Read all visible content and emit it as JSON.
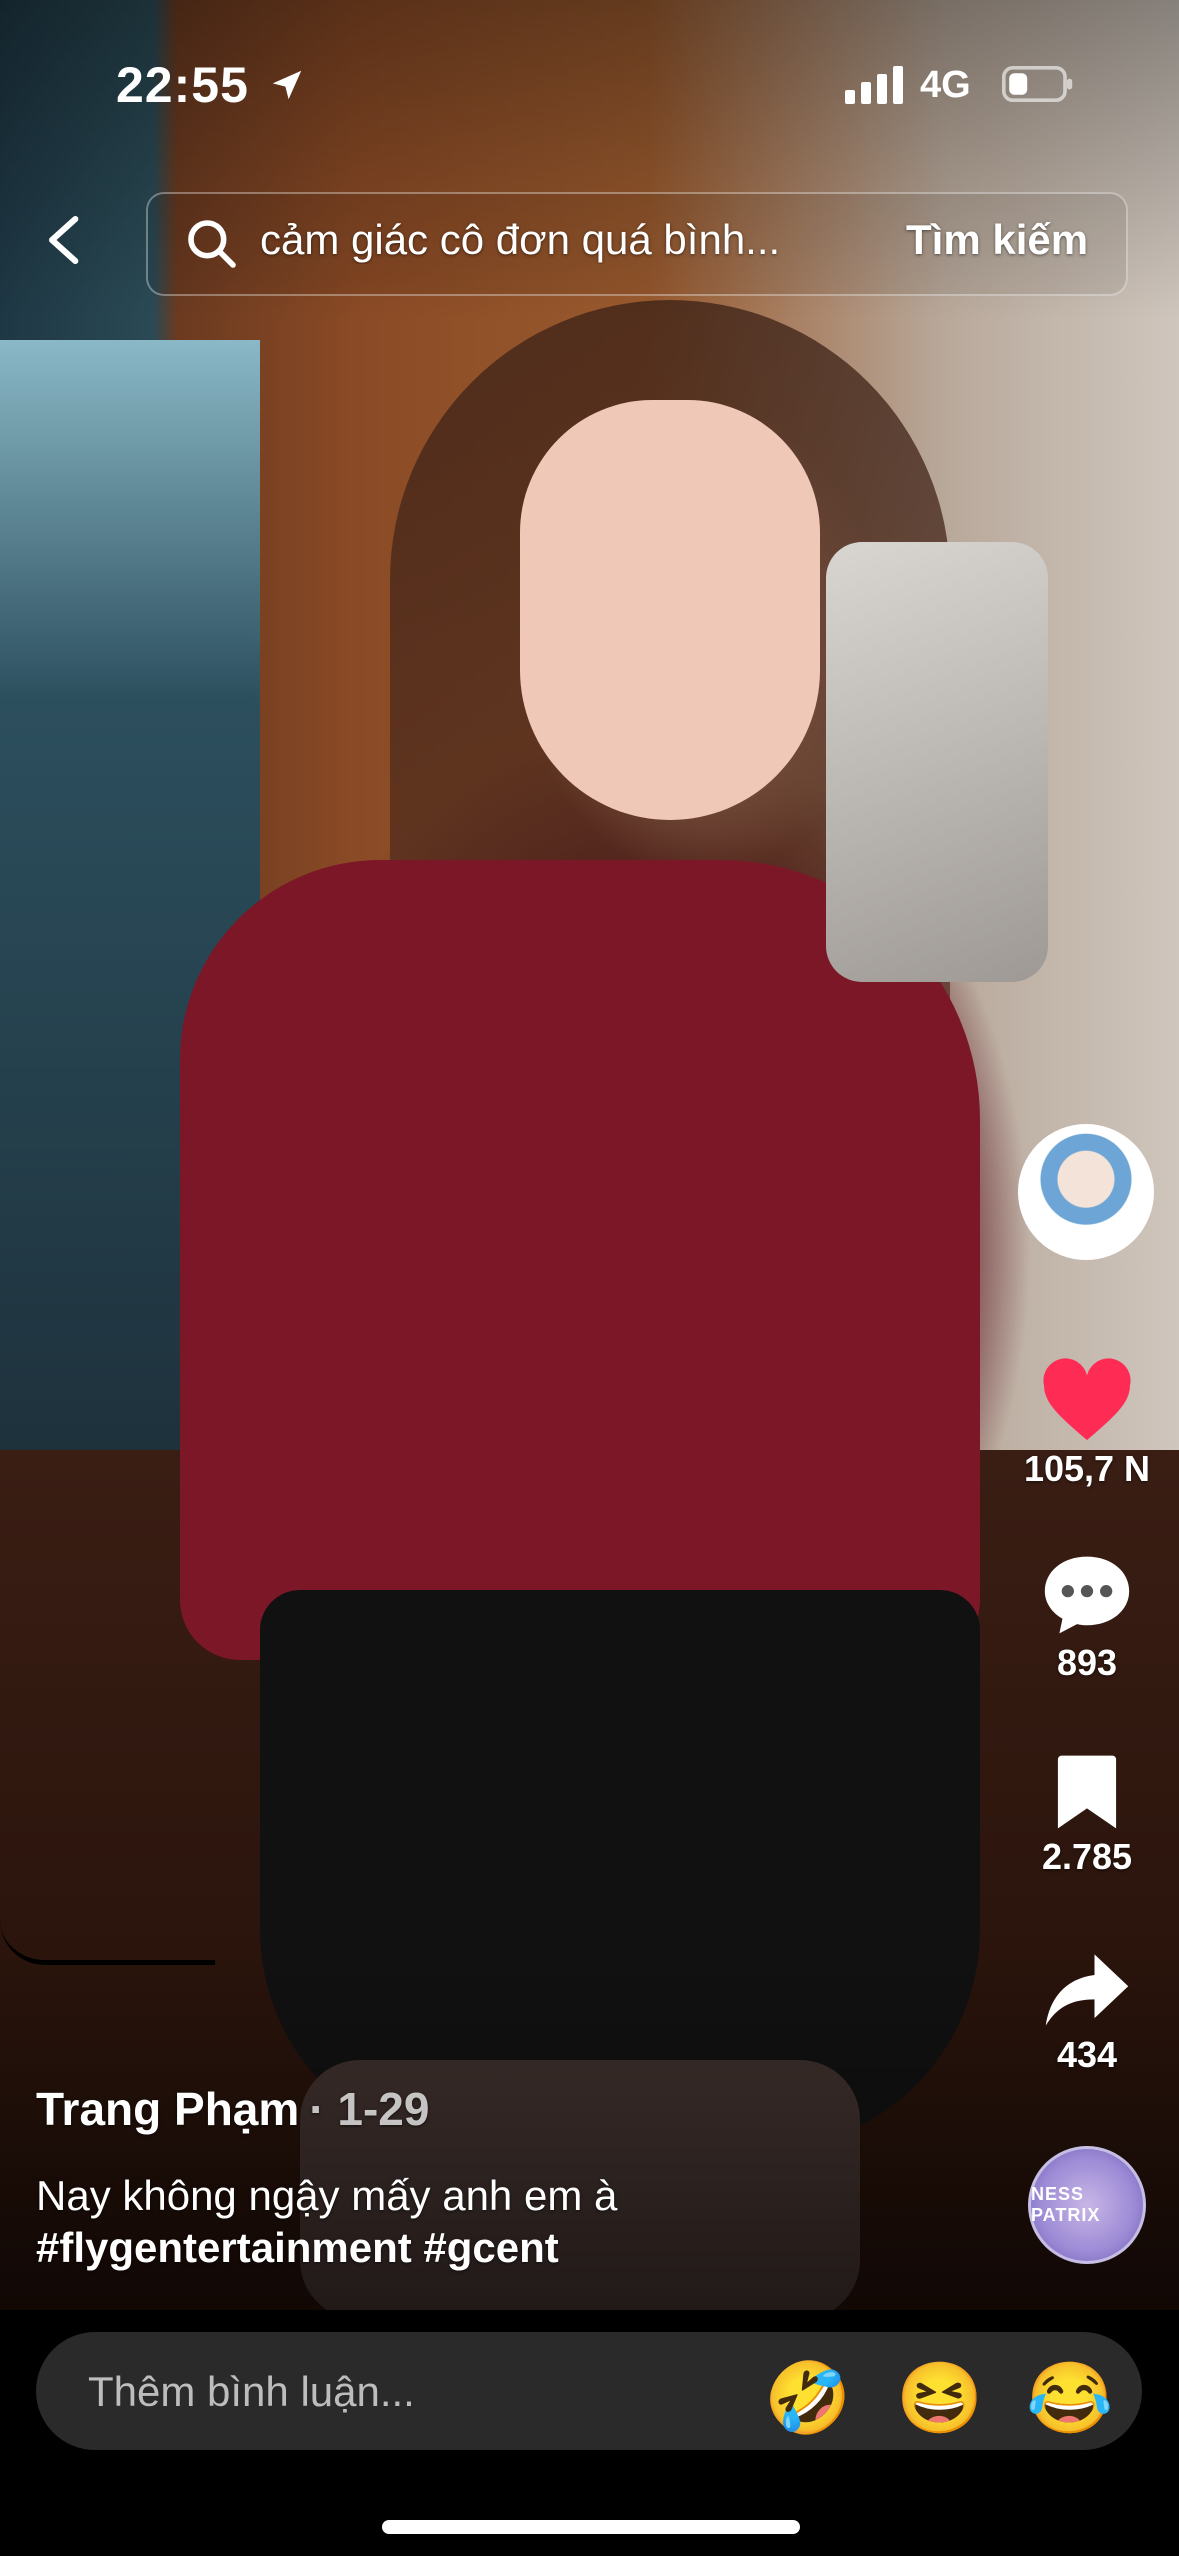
{
  "status_bar": {
    "time": "22:55",
    "network": "4G"
  },
  "search": {
    "query": "cảm giác cô đơn quá bình...",
    "button_label": "Tìm kiếm"
  },
  "actions": {
    "likes": "105,7 N",
    "comments": "893",
    "saves": "2.785",
    "shares": "434"
  },
  "post": {
    "author": "Trang Phạm",
    "date": "· 1-29",
    "caption": "Nay không ngậy mấy anh em à",
    "hashtags": "#flygentertainment #gcent"
  },
  "music_disc_text": "NESS PATRIX",
  "comment_bar": {
    "placeholder": "Thêm bình luận...",
    "emojis": [
      "🤣",
      "😆",
      "😂"
    ]
  },
  "colors": {
    "like_red": "#fe2c55",
    "comment_bar_bg": "#2a2a2a"
  }
}
